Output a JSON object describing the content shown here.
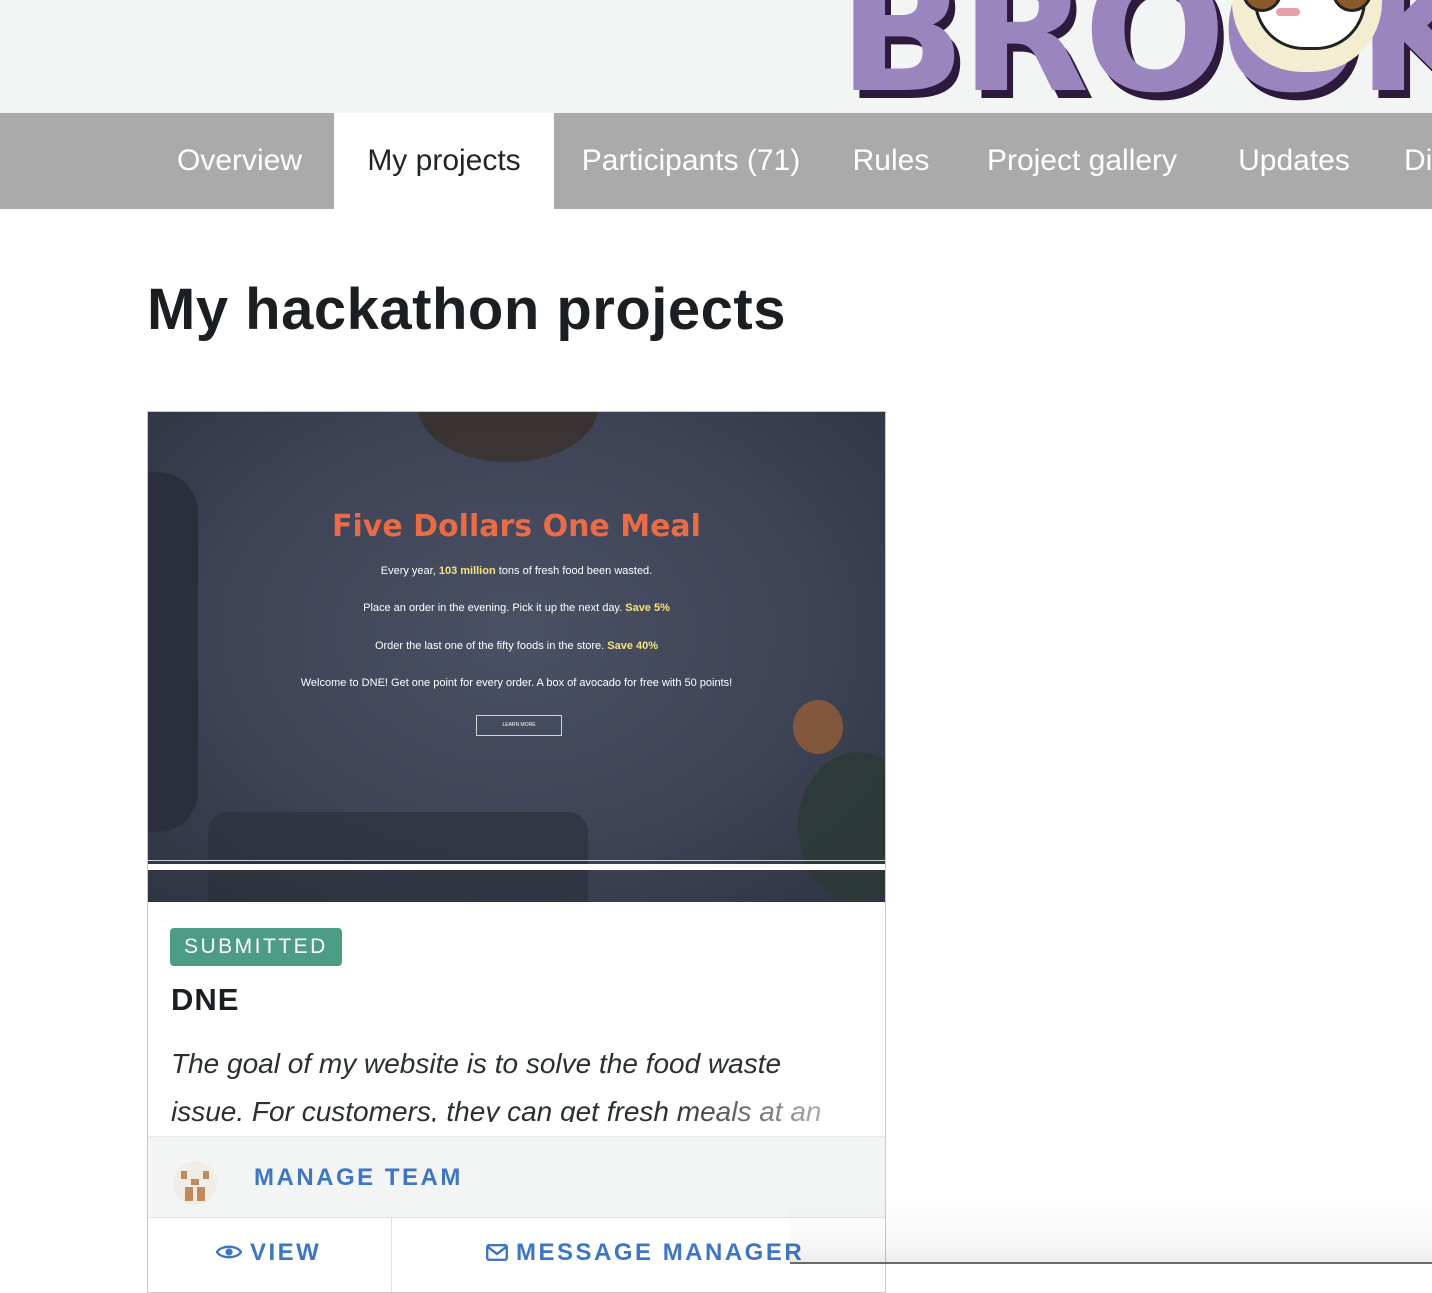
{
  "nav": {
    "tabs": [
      {
        "label": "Overview",
        "active": false
      },
      {
        "label": "My projects",
        "active": true
      },
      {
        "label": "Participants (71)",
        "active": false
      },
      {
        "label": "Rules",
        "active": false
      },
      {
        "label": "Project gallery",
        "active": false
      },
      {
        "label": "Updates",
        "active": false
      },
      {
        "label": "Di",
        "active": false
      }
    ]
  },
  "banner": {
    "logo_text": "BROOK"
  },
  "page": {
    "title": "My hackathon projects"
  },
  "project": {
    "status": "SUBMITTED",
    "name": "DNE",
    "description": "The goal of my website is to solve the food waste issue. For customers, they can get fresh meals at an",
    "thumbnail": {
      "title": "Five Dollars One Meal",
      "lines": [
        {
          "pre": "Every year, ",
          "highlight": "103 million",
          "post": " tons of fresh food been wasted."
        },
        {
          "pre": "Place an order in the evening. Pick it up the next day. ",
          "highlight": "Save 5%",
          "post": ""
        },
        {
          "pre": "Order the last one of the fifty foods in the store. ",
          "highlight": "Save 40%",
          "post": ""
        },
        {
          "pre": "Welcome to DNE! Get one point for every order. A box of avocado for free with 50 points!",
          "highlight": "",
          "post": ""
        }
      ],
      "button_label": "LEARN MORE"
    },
    "manage_team_label": "MANAGE TEAM",
    "view_label": "VIEW",
    "message_manager_label": "MESSAGE MANAGER"
  },
  "colors": {
    "nav_bg": "#a9aaa9",
    "badge_green": "#4c9c86",
    "link_blue": "#3d77c3",
    "logo_purple": "#9a85bf",
    "thumb_title_orange": "#e96b47"
  },
  "icons": {
    "view": "eye-icon",
    "message": "envelope-icon"
  }
}
